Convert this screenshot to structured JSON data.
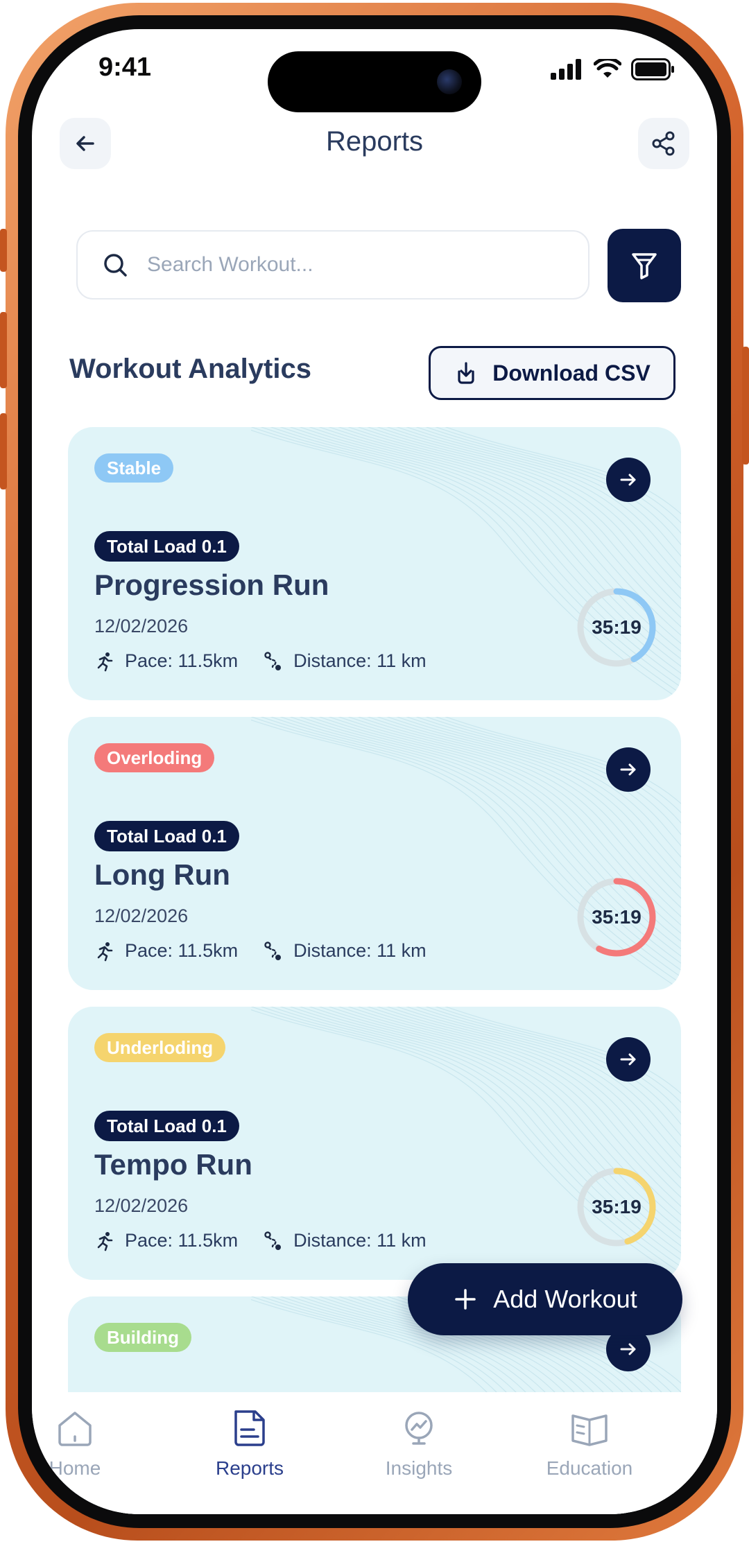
{
  "status_bar": {
    "time": "9:41"
  },
  "header": {
    "title": "Reports"
  },
  "search": {
    "placeholder": "Search Workout..."
  },
  "section": {
    "title": "Workout Analytics",
    "download_label": "Download CSV"
  },
  "workouts": [
    {
      "status": "Stable",
      "status_color": "#8ec8f5",
      "load": "Total Load 0.1",
      "title": "Progression Run",
      "date": "12/02/2026",
      "pace": "Pace: 11.5km",
      "distance": "Distance: 11 km",
      "time": "35:19",
      "ring_color": "#8ec8f5",
      "progress": 0.42
    },
    {
      "status": "Overloding",
      "status_color": "#f47a7a",
      "load": "Total Load 0.1",
      "title": "Long Run",
      "date": "12/02/2026",
      "pace": "Pace: 11.5km",
      "distance": "Distance: 11 km",
      "time": "35:19",
      "ring_color": "#f47a7a",
      "progress": 0.58
    },
    {
      "status": "Underloding",
      "status_color": "#f5d46e",
      "load": "Total Load 0.1",
      "title": "Tempo Run",
      "date": "12/02/2026",
      "pace": "Pace: 11.5km",
      "distance": "Distance: 11 km",
      "time": "35:19",
      "ring_color": "#f5d46e",
      "progress": 0.45
    },
    {
      "status": "Building",
      "status_color": "#a8dc8e"
    }
  ],
  "fab": {
    "label": "Add Workout"
  },
  "tabs": [
    {
      "label": "Home",
      "icon": "home-icon",
      "active": false
    },
    {
      "label": "Reports",
      "icon": "reports-icon",
      "active": true
    },
    {
      "label": "Insights",
      "icon": "insights-icon",
      "active": false
    },
    {
      "label": "Education",
      "icon": "education-icon",
      "active": false
    }
  ],
  "colors": {
    "primary": "#0c1a45",
    "card_bg": "#e0f4f8",
    "text": "#2a3b5e",
    "muted": "#9aa6b8",
    "active_tab": "#2b3f8c"
  }
}
